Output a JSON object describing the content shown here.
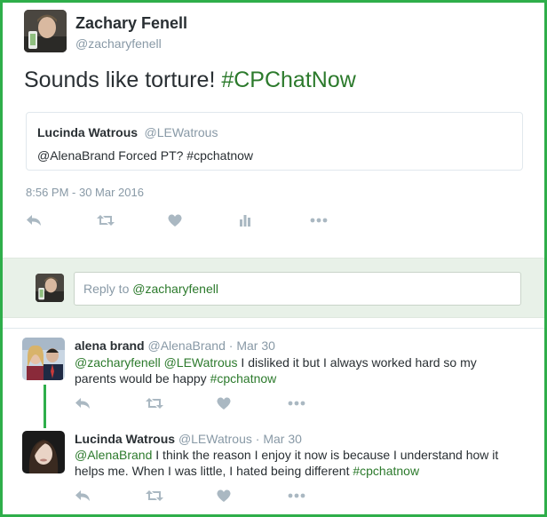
{
  "main_tweet": {
    "author_name": "Zachary Fenell",
    "author_handle": "@zacharyfenell",
    "text_plain": "Sounds like torture! ",
    "text_hashtag": "#CPChatNow",
    "timestamp": "8:56 PM - 30 Mar 2016",
    "quoted": {
      "author_name": "Lucinda Watrous",
      "author_handle": "@LEWatrous",
      "text": "@AlenaBrand Forced PT?  #cpchatnow"
    }
  },
  "reply_box": {
    "prefix": "Reply to ",
    "mention": "@zacharyfenell"
  },
  "replies": [
    {
      "author_name": "alena brand",
      "author_handle": "@AlenaBrand",
      "separator": "·",
      "date": "Mar 30",
      "mentions": "@zacharyfenell @LEWatrous",
      "text_line1_rest": " I disliked it but I always worked hard so my",
      "text_line2": "parents would be happy ",
      "hashtag": "#cpchatnow"
    },
    {
      "author_name": "Lucinda Watrous",
      "author_handle": "@LEWatrous",
      "separator": "·",
      "date": "Mar 30",
      "mentions": "@AlenaBrand",
      "text_line1_rest": " I think the reason I enjoy it now is because I understand how it",
      "text_line2": "helps me. When I was little, I hated being different ",
      "hashtag": "#cpchatnow"
    }
  ],
  "icons": {
    "reply": "reply-icon",
    "retweet": "retweet-icon",
    "like": "heart-icon",
    "analytics": "analytics-icon",
    "more": "more-icon"
  },
  "colors": {
    "frame": "#2eae4a",
    "hashtag": "#2c7a2c",
    "reply_bar": "#e8f1e8",
    "muted": "#8899a6",
    "icon": "#aab8c2"
  }
}
